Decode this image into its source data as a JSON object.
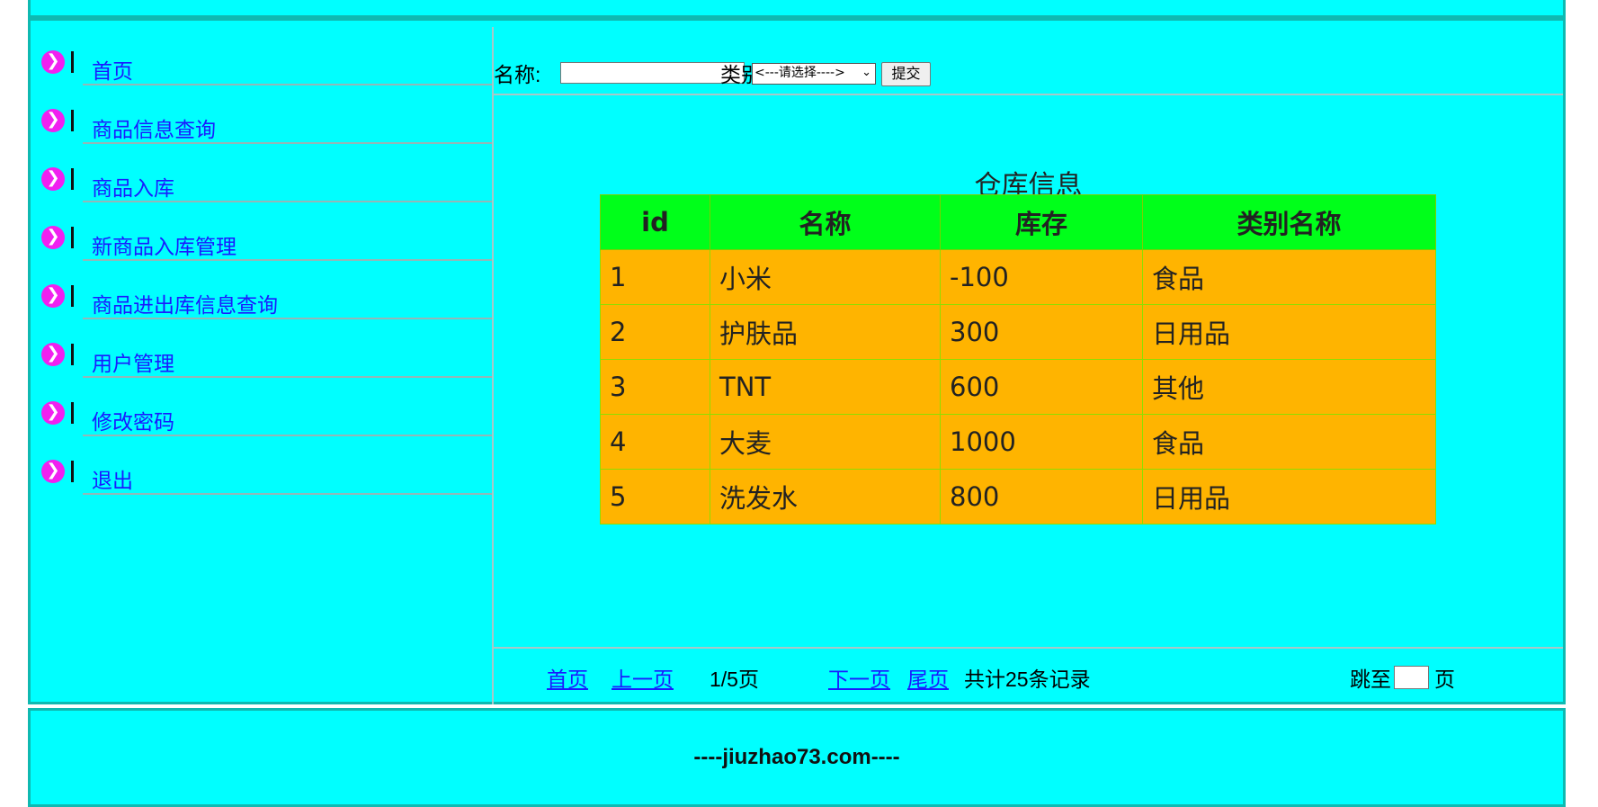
{
  "sidebar": {
    "items": [
      {
        "label": "首页"
      },
      {
        "label": "商品信息查询"
      },
      {
        "label": "商品入库"
      },
      {
        "label": "新商品入库管理"
      },
      {
        "label": "商品进出库信息查询"
      },
      {
        "label": "用户管理"
      },
      {
        "label": "修改密码"
      },
      {
        "label": "退出"
      }
    ],
    "bullet_glyph": "❯",
    "icon": "arrow-bullet-icon"
  },
  "search": {
    "name_label": "名称:",
    "type_label": "类别:",
    "name_value": "",
    "type_selected": "<---请选择---->",
    "submit_label": "提交"
  },
  "table": {
    "title": "仓库信息",
    "headers": [
      "id",
      "名称",
      "库存",
      "类别名称"
    ],
    "rows": [
      [
        "1",
        "小米",
        "-100",
        "食品"
      ],
      [
        "2",
        "护肤品",
        "300",
        "日用品"
      ],
      [
        "3",
        "TNT",
        "600",
        "其他"
      ],
      [
        "4",
        "大麦",
        "1000",
        "食品"
      ],
      [
        "5",
        "洗发水",
        "800",
        "日用品"
      ]
    ]
  },
  "pager": {
    "first": "首页",
    "prev": "上一页",
    "page_info": "1/5页",
    "next": "下一页",
    "last": "尾页",
    "total": "共计25条记录",
    "jump_prefix": "跳至",
    "jump_suffix": "页"
  },
  "footer": {
    "text": "----jiuzhao73.com----"
  },
  "colors": {
    "background": "#00ffff",
    "header_row": "#00ff1a",
    "data_row": "#ffb400",
    "link": "#1a1aff",
    "bullet": "#f020f0"
  }
}
